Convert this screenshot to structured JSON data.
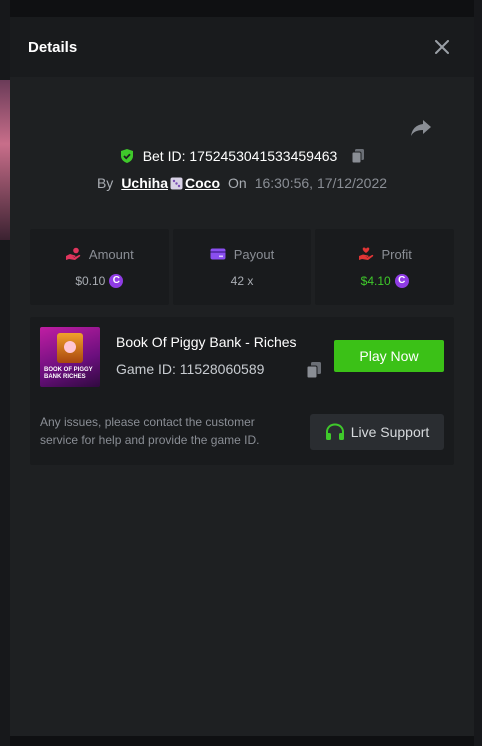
{
  "modal": {
    "title": "Details"
  },
  "bet": {
    "id_label": "Bet ID: 1752453041533459463",
    "by_label": "By",
    "username": "Uchiha",
    "username_suffix": "Coco",
    "on_label": "On",
    "time": "16:30:56, 17/12/2022"
  },
  "stats": {
    "amount": {
      "label": "Amount",
      "value": "$0.10"
    },
    "payout": {
      "label": "Payout",
      "value": "42 x"
    },
    "profit": {
      "label": "Profit",
      "value": "$4.10"
    }
  },
  "game": {
    "name": "Book Of Piggy Bank - Riches",
    "id_label": "Game ID: 11528060589",
    "thumb_text": "BOOK OF PIGGY BANK RICHES",
    "play_label": "Play Now"
  },
  "support": {
    "message": "Any issues, please contact the customer service for help and provide the game ID.",
    "button_label": "Live Support"
  },
  "coin_symbol": "C",
  "colors": {
    "accent_green": "#3bc117",
    "profit_green": "#3fc92b",
    "coin_purple": "#8f3ce4",
    "amount_icon": "#e0355d",
    "payout_icon": "#8a4ef0",
    "profit_icon": "#e03535",
    "support_icon": "#3fc92b"
  },
  "icons": {
    "close": "close-icon",
    "share": "share-icon",
    "verified": "shield-check-icon",
    "copy": "copy-icon",
    "dice": "dice-icon",
    "amount": "hand-coin-icon",
    "payout": "card-icon",
    "profit": "hand-heart-icon",
    "headphones": "headphones-icon"
  }
}
